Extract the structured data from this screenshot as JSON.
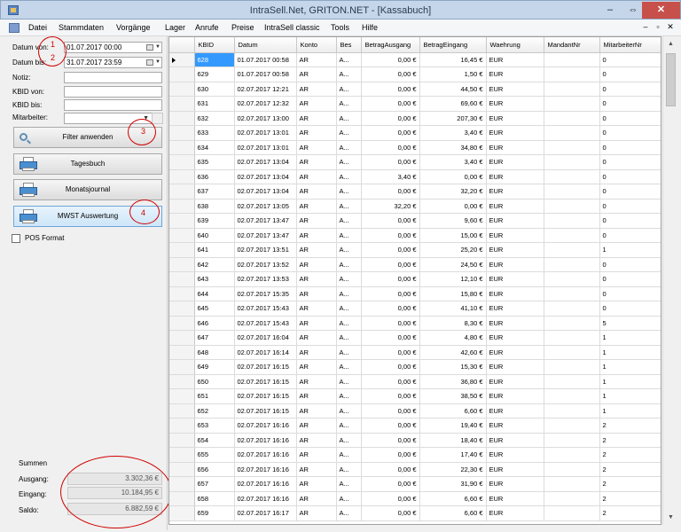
{
  "window": {
    "title": "IntraSell.Net, GRITON.NET - [Kassabuch]",
    "minimize": "–",
    "maximize": "⇔",
    "close": "✕"
  },
  "menu": {
    "items": [
      "Datei",
      "Stammdaten",
      "Vorgänge",
      "Lager",
      "Anrufe",
      "Preise",
      "IntraSell classic",
      "Tools",
      "Hilfe"
    ],
    "mdi_minimize": "–",
    "mdi_restore": "▫",
    "mdi_close": "✕"
  },
  "filter": {
    "datum_von_label": "Datum von:",
    "datum_von_value": "01.07.2017 00:00",
    "datum_bis_label": "Datum bis:",
    "datum_bis_value": "31.07.2017 23:59",
    "notiz_label": "Notiz:",
    "kbid_von_label": "KBID von:",
    "kbid_bis_label": "KBID bis:",
    "mitarbeiter_label": "Mitarbeiter:",
    "filter_button": "Filter anwenden",
    "tagesbuch_button": "Tagesbuch",
    "monatsjournal_button": "Monatsjournal",
    "mwst_button": "MWST Auswertung",
    "pos_format_label": "POS Format",
    "pos_format_checked": false
  },
  "summen": {
    "title": "Summen",
    "ausgang_label": "Ausgang:",
    "ausgang_value": "3.302,36 €",
    "eingang_label": "Eingang:",
    "eingang_value": "10.184,95 €",
    "saldo_label": "Saldo:",
    "saldo_value": "6.882,59 €"
  },
  "annotations": {
    "marker_1": "1",
    "marker_2": "2",
    "marker_3": "3",
    "marker_4": "4",
    "marker_color": "#d00000"
  },
  "grid": {
    "columns": [
      "KBID",
      "Datum",
      "Konto",
      "Bes",
      "BetragAusgang",
      "BetragEingang",
      "Waehrung",
      "MandantNr",
      "MitarbeiterNr"
    ],
    "selected_kbid": "628",
    "rows": [
      [
        "628",
        "01.07.2017 00:58",
        "AR",
        "A...",
        "0,00 €",
        "16,45 €",
        "EUR",
        "",
        "0"
      ],
      [
        "629",
        "01.07.2017 00:58",
        "AR",
        "A...",
        "0,00 €",
        "1,50 €",
        "EUR",
        "",
        "0"
      ],
      [
        "630",
        "02.07.2017 12:21",
        "AR",
        "A...",
        "0,00 €",
        "44,50 €",
        "EUR",
        "",
        "0"
      ],
      [
        "631",
        "02.07.2017 12:32",
        "AR",
        "A...",
        "0,00 €",
        "69,60 €",
        "EUR",
        "",
        "0"
      ],
      [
        "632",
        "02.07.2017 13:00",
        "AR",
        "A...",
        "0,00 €",
        "207,30 €",
        "EUR",
        "",
        "0"
      ],
      [
        "633",
        "02.07.2017 13:01",
        "AR",
        "A...",
        "0,00 €",
        "3,40 €",
        "EUR",
        "",
        "0"
      ],
      [
        "634",
        "02.07.2017 13:01",
        "AR",
        "A...",
        "0,00 €",
        "34,80 €",
        "EUR",
        "",
        "0"
      ],
      [
        "635",
        "02.07.2017 13:04",
        "AR",
        "A...",
        "0,00 €",
        "3,40 €",
        "EUR",
        "",
        "0"
      ],
      [
        "636",
        "02.07.2017 13:04",
        "AR",
        "A...",
        "3,40 €",
        "0,00 €",
        "EUR",
        "",
        "0"
      ],
      [
        "637",
        "02.07.2017 13:04",
        "AR",
        "A...",
        "0,00 €",
        "32,20 €",
        "EUR",
        "",
        "0"
      ],
      [
        "638",
        "02.07.2017 13:05",
        "AR",
        "A...",
        "32,20 €",
        "0,00 €",
        "EUR",
        "",
        "0"
      ],
      [
        "639",
        "02.07.2017 13:47",
        "AR",
        "A...",
        "0,00 €",
        "9,60 €",
        "EUR",
        "",
        "0"
      ],
      [
        "640",
        "02.07.2017 13:47",
        "AR",
        "A...",
        "0,00 €",
        "15,00 €",
        "EUR",
        "",
        "0"
      ],
      [
        "641",
        "02.07.2017 13:51",
        "AR",
        "A...",
        "0,00 €",
        "25,20 €",
        "EUR",
        "",
        "1"
      ],
      [
        "642",
        "02.07.2017 13:52",
        "AR",
        "A...",
        "0,00 €",
        "24,50 €",
        "EUR",
        "",
        "0"
      ],
      [
        "643",
        "02.07.2017 13:53",
        "AR",
        "A...",
        "0,00 €",
        "12,10 €",
        "EUR",
        "",
        "0"
      ],
      [
        "644",
        "02.07.2017 15:35",
        "AR",
        "A...",
        "0,00 €",
        "15,80 €",
        "EUR",
        "",
        "0"
      ],
      [
        "645",
        "02.07.2017 15:43",
        "AR",
        "A...",
        "0,00 €",
        "41,10 €",
        "EUR",
        "",
        "0"
      ],
      [
        "646",
        "02.07.2017 15:43",
        "AR",
        "A...",
        "0,00 €",
        "8,30 €",
        "EUR",
        "",
        "5"
      ],
      [
        "647",
        "02.07.2017 16:04",
        "AR",
        "A...",
        "0,00 €",
        "4,80 €",
        "EUR",
        "",
        "1"
      ],
      [
        "648",
        "02.07.2017 16:14",
        "AR",
        "A...",
        "0,00 €",
        "42,60 €",
        "EUR",
        "",
        "1"
      ],
      [
        "649",
        "02.07.2017 16:15",
        "AR",
        "A...",
        "0,00 €",
        "15,30 €",
        "EUR",
        "",
        "1"
      ],
      [
        "650",
        "02.07.2017 16:15",
        "AR",
        "A...",
        "0,00 €",
        "36,80 €",
        "EUR",
        "",
        "1"
      ],
      [
        "651",
        "02.07.2017 16:15",
        "AR",
        "A...",
        "0,00 €",
        "38,50 €",
        "EUR",
        "",
        "1"
      ],
      [
        "652",
        "02.07.2017 16:15",
        "AR",
        "A...",
        "0,00 €",
        "6,60 €",
        "EUR",
        "",
        "1"
      ],
      [
        "653",
        "02.07.2017 16:16",
        "AR",
        "A...",
        "0,00 €",
        "19,40 €",
        "EUR",
        "",
        "2"
      ],
      [
        "654",
        "02.07.2017 16:16",
        "AR",
        "A...",
        "0,00 €",
        "18,40 €",
        "EUR",
        "",
        "2"
      ],
      [
        "655",
        "02.07.2017 16:16",
        "AR",
        "A...",
        "0,00 €",
        "17,40 €",
        "EUR",
        "",
        "2"
      ],
      [
        "656",
        "02.07.2017 16:16",
        "AR",
        "A...",
        "0,00 €",
        "22,30 €",
        "EUR",
        "",
        "2"
      ],
      [
        "657",
        "02.07.2017 16:16",
        "AR",
        "A...",
        "0,00 €",
        "31,90 €",
        "EUR",
        "",
        "2"
      ],
      [
        "658",
        "02.07.2017 16:16",
        "AR",
        "A...",
        "0,00 €",
        "6,60 €",
        "EUR",
        "",
        "2"
      ],
      [
        "659",
        "02.07.2017 16:17",
        "AR",
        "A...",
        "0,00 €",
        "6,60 €",
        "EUR",
        "",
        "2"
      ]
    ]
  },
  "scrollbar": {
    "up": "▲",
    "down": "▼"
  }
}
